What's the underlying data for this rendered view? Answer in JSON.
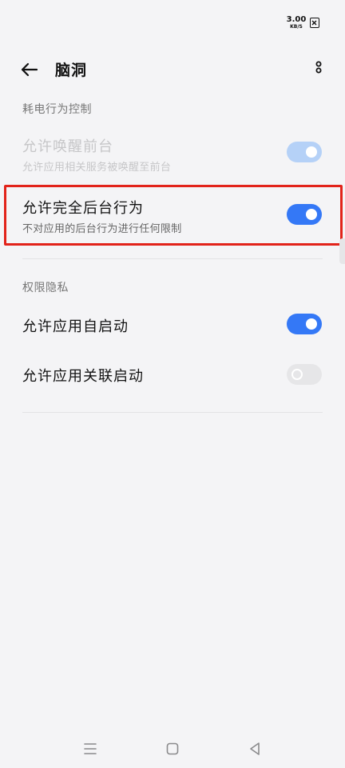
{
  "status_bar": {
    "net_speed_value": "3.00",
    "net_speed_unit": "KB/S",
    "sim_icon": "no-sim-icon"
  },
  "app_bar": {
    "back_icon": "arrow-left-icon",
    "title": "脑洞",
    "more_icon": "more-vertical-icon"
  },
  "sections": {
    "power": {
      "header": "耗电行为控制",
      "items": [
        {
          "title": "允许唤醒前台",
          "subtitle": "允许应用相关服务被唤醒至前台",
          "state": "on-disabled"
        },
        {
          "title": "允许完全后台行为",
          "subtitle": "不对应用的后台行为进行任何限制",
          "state": "on",
          "highlighted": true
        }
      ]
    },
    "privacy": {
      "header": "权限隐私",
      "items": [
        {
          "title": "允许应用自启动",
          "state": "on"
        },
        {
          "title": "允许应用关联启动",
          "state": "off"
        }
      ]
    }
  },
  "nav_bar": {
    "menu_icon": "menu-icon",
    "home_icon": "home-icon",
    "back_icon": "back-triangle-icon"
  },
  "colors": {
    "accent": "#3478f6",
    "accent_disabled": "#b5d1f7",
    "highlight": "#e2231a",
    "background": "#f4f4f6"
  }
}
